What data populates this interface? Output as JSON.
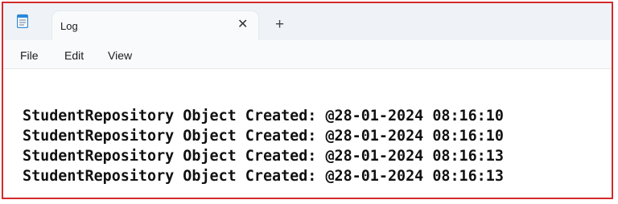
{
  "tab": {
    "title": "Log",
    "close_glyph": "✕",
    "new_tab_glyph": "+"
  },
  "menu": {
    "items": [
      "File",
      "Edit",
      "View"
    ]
  },
  "editor": {
    "lines": [
      "StudentRepository Object Created: @28-01-2024 08:16:10",
      "StudentRepository Object Created: @28-01-2024 08:16:10",
      "StudentRepository Object Created: @28-01-2024 08:16:13",
      "StudentRepository Object Created: @28-01-2024 08:16:13"
    ]
  },
  "icons": {
    "app": "notepad-icon",
    "close": "close-icon",
    "new_tab": "plus-icon"
  },
  "colors": {
    "border": "#d42a2a",
    "titlebar": "#eff3f7",
    "tab": "#f9fafc",
    "icon_accent": "#2b88d8",
    "text": "#111111"
  }
}
